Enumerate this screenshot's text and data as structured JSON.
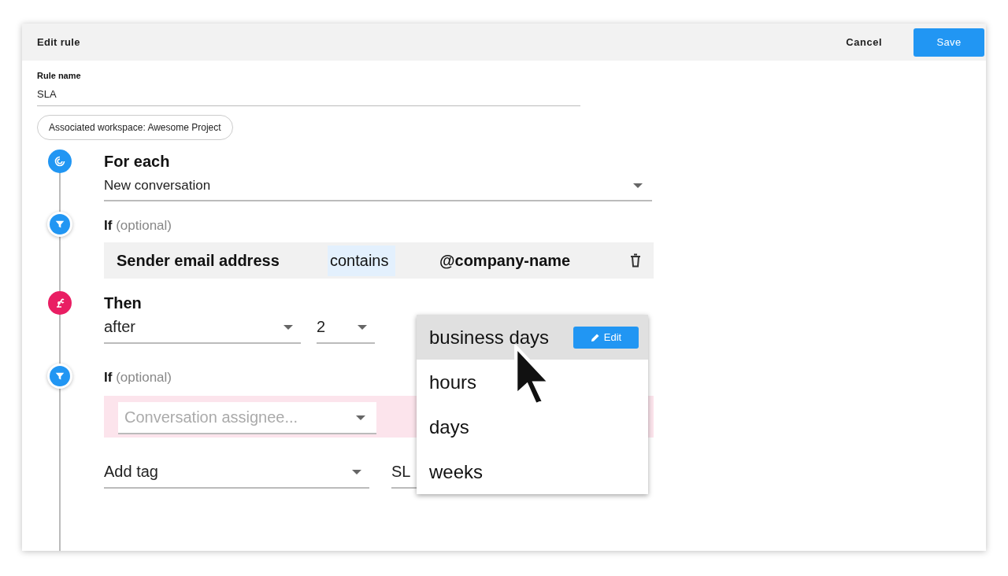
{
  "header": {
    "title": "Edit rule",
    "cancel": "Cancel",
    "save": "Save"
  },
  "rule_name": {
    "label": "Rule name",
    "value": "SLA"
  },
  "workspace_chip": "Associated workspace: Awesome Project",
  "steps": [
    {
      "kind": "trigger",
      "title": "For each",
      "select": "New conversation"
    },
    {
      "kind": "filter",
      "title": "If",
      "hint": "(optional)",
      "condition": {
        "field": "Sender email address",
        "operator": "contains",
        "value": "@company-name"
      }
    },
    {
      "kind": "action",
      "title": "Then",
      "delay": "after",
      "amount": "2",
      "unit_menu": [
        {
          "label": "business days",
          "selected": true,
          "edit": "Edit"
        },
        {
          "label": "hours",
          "selected": false
        },
        {
          "label": "days",
          "selected": false
        },
        {
          "label": "weeks",
          "selected": false
        }
      ]
    },
    {
      "kind": "filter_pending",
      "title": "If",
      "hint": "(optional)",
      "placeholder": "Conversation assignee...",
      "action_select": "Add tag",
      "tag_value": "SL"
    }
  ]
}
